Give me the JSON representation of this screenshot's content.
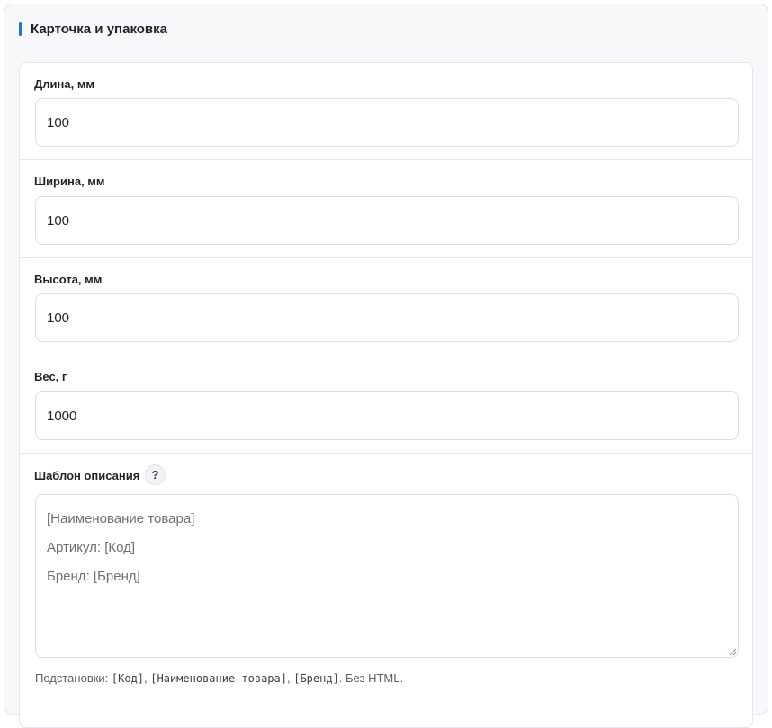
{
  "section": {
    "title": "Карточка и упаковка",
    "accent_color": "#1f6feb"
  },
  "fields": {
    "length": {
      "label": "Длина, мм",
      "value": "100"
    },
    "width": {
      "label": "Ширина, мм",
      "value": "100"
    },
    "height": {
      "label": "Высота, мм",
      "value": "100"
    },
    "weight": {
      "label": "Вес, г",
      "value": "1000"
    }
  },
  "description_template": {
    "label": "Шаблон описания",
    "help_icon": "question-mark-icon",
    "help_symbol": "?",
    "placeholder_lines": [
      "[Наименование товара]",
      "Артикул: [Код]",
      "Бренд: [Бренд]"
    ],
    "hint": {
      "prefix": "Подстановки: ",
      "token_code": "[Код]",
      "sep1": ", ",
      "token_name": "[Наименование товара]",
      "sep2": ", ",
      "token_brand": "[Бренд]",
      "suffix": ". Без HTML."
    }
  }
}
